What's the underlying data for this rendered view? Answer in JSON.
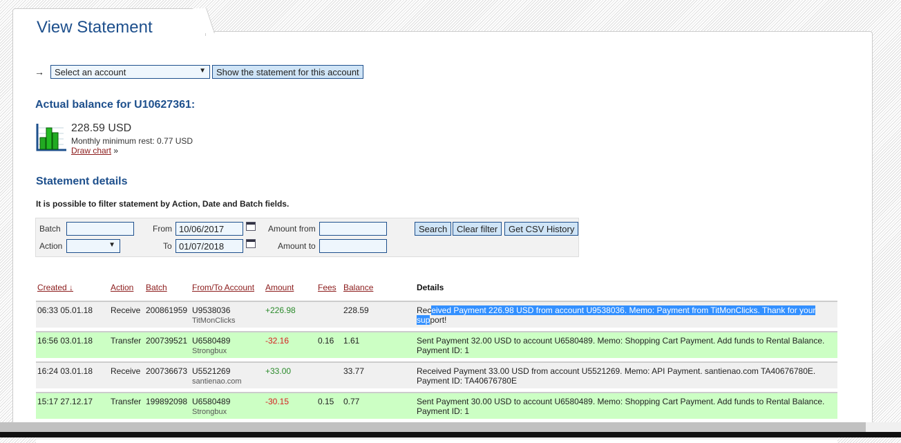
{
  "page_title": "View Statement",
  "account_select": {
    "value": "Select an account",
    "button": "Show the statement for this account"
  },
  "balance": {
    "heading": "Actual balance for U10627361:",
    "amount": "228.59 USD",
    "min_rest": "Monthly minimum rest: 0.77 USD",
    "draw_chart": "Draw chart",
    "draw_chart_suffix": "»"
  },
  "statement": {
    "heading": "Statement details",
    "note": "It is possible to filter statement by Action, Date and Batch fields.",
    "filter": {
      "batch_label": "Batch",
      "batch_value": "",
      "action_label": "Action",
      "action_value": "",
      "from_label": "From",
      "from_value": "10/06/2017",
      "to_label": "To",
      "to_value": "01/07/2018",
      "amount_from_label": "Amount from",
      "amount_from_value": "",
      "amount_to_label": "Amount to",
      "amount_to_value": "",
      "search": "Search",
      "clear": "Clear filter",
      "csv": "Get CSV History"
    },
    "columns": [
      "Created ↓",
      "Action",
      "Batch",
      "From/To Account",
      "Amount",
      "Fees",
      "Balance",
      "Details"
    ],
    "rows": [
      {
        "created": "06:33 05.01.18",
        "action": "Receive",
        "batch": "200861959",
        "account": "U9538036",
        "account_name": "TitMonClicks",
        "amount": "+226.98",
        "fees": "",
        "balance": "228.59",
        "details_a": "Rec",
        "details_sel": "eived Payment 226.98 USD from account U9538036. Memo: Payment from TitMonClicks. Thank for your sup",
        "details_b": "port!"
      },
      {
        "created": "16:56 03.01.18",
        "action": "Transfer",
        "batch": "200739521",
        "account": "U6580489",
        "account_name": "Strongbux",
        "amount": "-32.16",
        "fees": "0.16",
        "balance": "1.61",
        "details": "Sent Payment 32.00 USD to account U6580489. Memo: Shopping Cart Payment. Add funds to Rental Balance. Payment ID: 1"
      },
      {
        "created": "16:24 03.01.18",
        "action": "Receive",
        "batch": "200736673",
        "account": "U5521269",
        "account_name": "santienao.com",
        "amount": "+33.00",
        "fees": "",
        "balance": "33.77",
        "details": "Received Payment 33.00 USD from account U5521269. Memo: API Payment. santienao.com TA40676780E. Payment ID: TA40676780E"
      },
      {
        "created": "15:17 27.12.17",
        "action": "Transfer",
        "batch": "199892098",
        "account": "U6580489",
        "account_name": "Strongbux",
        "amount": "-30.15",
        "fees": "0.15",
        "balance": "0.77",
        "details": "Sent Payment 30.00 USD to account U6580489. Memo: Shopping Cart Payment. Add funds to Rental Balance. Payment ID: 1"
      }
    ]
  }
}
